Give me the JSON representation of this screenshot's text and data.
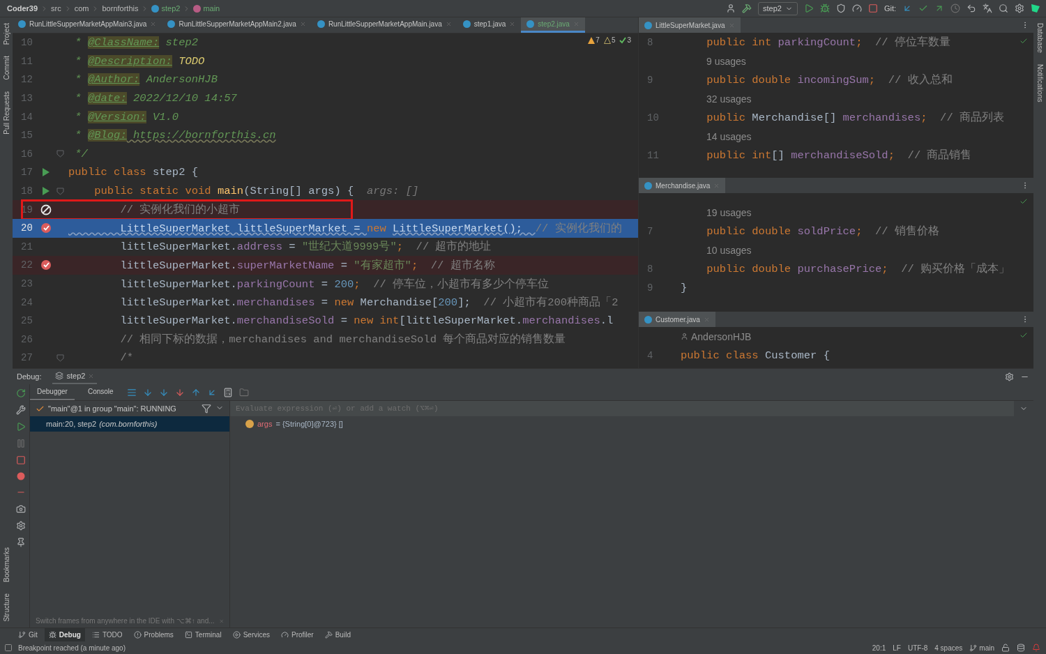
{
  "breadcrumbs": [
    {
      "label": "Coder39",
      "kind": "project"
    },
    {
      "label": "src",
      "kind": "folder"
    },
    {
      "label": "com",
      "kind": "folder"
    },
    {
      "label": "bornforthis",
      "kind": "folder"
    },
    {
      "label": "step2",
      "kind": "class"
    },
    {
      "label": "main",
      "kind": "method"
    }
  ],
  "run_config": "step2",
  "git_label": "Git:",
  "left_tools_top": [
    "Project",
    "Commit",
    "Pull Requests"
  ],
  "left_tools_bottom": [
    "Bookmarks",
    "Structure"
  ],
  "right_tools": [
    "Database",
    "Notifications"
  ],
  "editor": {
    "tabs": [
      {
        "label": "RunLittleSupperMarketAppMain3.java",
        "selected": false
      },
      {
        "label": "RunLittleSupperMarketAppMain2.java",
        "selected": false
      },
      {
        "label": "RunLittleSupperMarketAppMain.java",
        "selected": false
      },
      {
        "label": "step1.java",
        "selected": false
      },
      {
        "label": "step2.java",
        "selected": true
      }
    ],
    "inspections": [
      {
        "kind": "warning",
        "count": "7"
      },
      {
        "kind": "weak",
        "count": "5"
      },
      {
        "kind": "ok",
        "count": "3"
      }
    ],
    "lines": [
      {
        "number": "10",
        "run": false,
        "fold": false,
        "breakpoint": false,
        "muted": false,
        "current": false,
        "tokens": [
          {
            "text": " * ",
            "kind": "doc"
          },
          {
            "text": "@ClassName:",
            "kind": "tag"
          },
          {
            "text": " step2",
            "kind": "doc"
          }
        ]
      },
      {
        "number": "11",
        "run": false,
        "fold": false,
        "breakpoint": false,
        "muted": false,
        "current": false,
        "tokens": [
          {
            "text": " * ",
            "kind": "doc"
          },
          {
            "text": "@Description:",
            "kind": "tag"
          },
          {
            "text": " TODO",
            "kind": "todo"
          }
        ]
      },
      {
        "number": "12",
        "run": false,
        "fold": false,
        "breakpoint": false,
        "muted": false,
        "current": false,
        "tokens": [
          {
            "text": " * ",
            "kind": "doc"
          },
          {
            "text": "@Author:",
            "kind": "tag"
          },
          {
            "text": " AndersonHJB",
            "kind": "doc"
          }
        ]
      },
      {
        "number": "13",
        "run": false,
        "fold": false,
        "breakpoint": false,
        "muted": false,
        "current": false,
        "tokens": [
          {
            "text": " * ",
            "kind": "doc"
          },
          {
            "text": "@date:",
            "kind": "tag"
          },
          {
            "text": " 2022/12/10 14:57",
            "kind": "doc"
          }
        ]
      },
      {
        "number": "14",
        "run": false,
        "fold": false,
        "breakpoint": false,
        "muted": false,
        "current": false,
        "tokens": [
          {
            "text": " * ",
            "kind": "doc"
          },
          {
            "text": "@Version:",
            "kind": "tag"
          },
          {
            "text": " V1.0",
            "kind": "doc"
          }
        ]
      },
      {
        "number": "15",
        "run": false,
        "fold": false,
        "breakpoint": false,
        "muted": false,
        "current": false,
        "tokens": [
          {
            "text": " * ",
            "kind": "doc"
          },
          {
            "text": "@Blog:",
            "kind": "tag"
          },
          {
            "text": " https://bornforthis.cn",
            "kind": "url"
          }
        ]
      },
      {
        "number": "16",
        "run": false,
        "fold": true,
        "breakpoint": false,
        "muted": false,
        "current": false,
        "tokens": [
          {
            "text": " */",
            "kind": "doc"
          }
        ]
      },
      {
        "number": "17",
        "run": true,
        "fold": false,
        "breakpoint": false,
        "muted": false,
        "current": false,
        "tokens": [
          {
            "text": "public class ",
            "kind": "kw"
          },
          {
            "text": "step2 {",
            "kind": "pl"
          }
        ]
      },
      {
        "number": "18",
        "run": true,
        "fold": true,
        "breakpoint": false,
        "muted": false,
        "current": false,
        "tokens": [
          {
            "text": "    public static void ",
            "kind": "kw"
          },
          {
            "text": "main",
            "kind": "fn"
          },
          {
            "text": "(String[] args) {  ",
            "kind": "pl"
          },
          {
            "text": "args: []",
            "kind": "hint"
          }
        ]
      },
      {
        "number": "19",
        "run": false,
        "fold": false,
        "breakpoint": true,
        "muted": true,
        "current": false,
        "boxed": true,
        "tokens": [
          {
            "text": "        // 实例化我们的小超市",
            "kind": "cm"
          }
        ]
      },
      {
        "number": "20",
        "run": false,
        "fold": false,
        "breakpoint": true,
        "muted": false,
        "current": true,
        "tokens": [
          {
            "text": "        LittleSuperMarket littleSuperMarket = ",
            "kind": "cur"
          },
          {
            "text": "new ",
            "kind": "kw"
          },
          {
            "text": "LittleSuperMarket();  ",
            "kind": "cur"
          },
          {
            "text": "// 实例化我们的",
            "kind": "cm"
          }
        ]
      },
      {
        "number": "21",
        "run": false,
        "fold": false,
        "breakpoint": false,
        "muted": false,
        "current": false,
        "tokens": [
          {
            "text": "        littleSuperMarket.",
            "kind": "pl"
          },
          {
            "text": "address",
            "kind": "fld"
          },
          {
            "text": " = ",
            "kind": "pl"
          },
          {
            "text": "\"世纪大道9999号\"",
            "kind": "str"
          },
          {
            "text": ";  ",
            "kind": "kw"
          },
          {
            "text": "// 超市的地址",
            "kind": "cm"
          }
        ]
      },
      {
        "number": "22",
        "run": false,
        "fold": false,
        "breakpoint": true,
        "muted": false,
        "current": false,
        "tokens": [
          {
            "text": "        littleSuperMarket.",
            "kind": "pl"
          },
          {
            "text": "superMarketName",
            "kind": "fld"
          },
          {
            "text": " = ",
            "kind": "pl"
          },
          {
            "text": "\"有家超市\"",
            "kind": "str"
          },
          {
            "text": ";  ",
            "kind": "kw"
          },
          {
            "text": "// 超市名称",
            "kind": "cm"
          }
        ]
      },
      {
        "number": "23",
        "run": false,
        "fold": false,
        "breakpoint": false,
        "muted": false,
        "current": false,
        "tokens": [
          {
            "text": "        littleSuperMarket.",
            "kind": "pl"
          },
          {
            "text": "parkingCount",
            "kind": "fld"
          },
          {
            "text": " = ",
            "kind": "pl"
          },
          {
            "text": "200",
            "kind": "num"
          },
          {
            "text": ";  ",
            "kind": "kw"
          },
          {
            "text": "// 停车位，小超市有多少个停车位",
            "kind": "cm"
          }
        ]
      },
      {
        "number": "24",
        "run": false,
        "fold": false,
        "breakpoint": false,
        "muted": false,
        "current": false,
        "tokens": [
          {
            "text": "        littleSuperMarket.",
            "kind": "pl"
          },
          {
            "text": "merchandises",
            "kind": "fld"
          },
          {
            "text": " = ",
            "kind": "pl"
          },
          {
            "text": "new ",
            "kind": "kw"
          },
          {
            "text": "Merchandise[",
            "kind": "pl"
          },
          {
            "text": "200",
            "kind": "num"
          },
          {
            "text": "];  ",
            "kind": "pl"
          },
          {
            "text": "// 小超市有200种商品「2",
            "kind": "cm"
          }
        ]
      },
      {
        "number": "25",
        "run": false,
        "fold": false,
        "breakpoint": false,
        "muted": false,
        "current": false,
        "tokens": [
          {
            "text": "        littleSuperMarket.",
            "kind": "pl"
          },
          {
            "text": "merchandiseSold",
            "kind": "fld"
          },
          {
            "text": " = ",
            "kind": "pl"
          },
          {
            "text": "new int",
            "kind": "kw"
          },
          {
            "text": "[littleSuperMarket.",
            "kind": "pl"
          },
          {
            "text": "merchandises",
            "kind": "fld"
          },
          {
            "text": ".l",
            "kind": "pl"
          }
        ]
      },
      {
        "number": "26",
        "run": false,
        "fold": false,
        "breakpoint": false,
        "muted": false,
        "current": false,
        "tokens": [
          {
            "text": "        // 相同下标的数据，merchandises and merchandiseSold 每个商品对应的销售数量",
            "kind": "cm"
          }
        ]
      },
      {
        "number": "27",
        "run": false,
        "fold": true,
        "breakpoint": false,
        "muted": false,
        "current": false,
        "tokens": [
          {
            "text": "        /*",
            "kind": "cm"
          }
        ]
      }
    ]
  },
  "side_editors": [
    {
      "file": "LittleSuperMarket.java",
      "rows": [
        {
          "kind": "code",
          "number": "8",
          "tokens": [
            {
              "text": "    public int ",
              "kind": "kw"
            },
            {
              "text": "parkingCount",
              "kind": "fld"
            },
            {
              "text": ";  ",
              "kind": "kw"
            },
            {
              "text": "// 停位车数量",
              "kind": "cm"
            }
          ]
        },
        {
          "kind": "usages",
          "text": "9 usages"
        },
        {
          "kind": "code",
          "number": "9",
          "tokens": [
            {
              "text": "    public double ",
              "kind": "kw"
            },
            {
              "text": "incomingSum",
              "kind": "fld"
            },
            {
              "text": ";  ",
              "kind": "kw"
            },
            {
              "text": "// 收入总和",
              "kind": "cm"
            }
          ]
        },
        {
          "kind": "usages",
          "text": "32 usages"
        },
        {
          "kind": "code",
          "number": "10",
          "tokens": [
            {
              "text": "    public ",
              "kind": "kw"
            },
            {
              "text": "Merchandise[] ",
              "kind": "pl"
            },
            {
              "text": "merchandises",
              "kind": "fld"
            },
            {
              "text": ";  ",
              "kind": "kw"
            },
            {
              "text": "// 商品列表",
              "kind": "cm"
            }
          ]
        },
        {
          "kind": "usages",
          "text": "14 usages"
        },
        {
          "kind": "code",
          "number": "11",
          "tokens": [
            {
              "text": "    public int",
              "kind": "kw"
            },
            {
              "text": "[] ",
              "kind": "pl"
            },
            {
              "text": "merchandiseSold",
              "kind": "fld"
            },
            {
              "text": ";  ",
              "kind": "kw"
            },
            {
              "text": "// 商品销售",
              "kind": "cm"
            }
          ]
        }
      ]
    },
    {
      "file": "Merchandise.java",
      "rows": [
        {
          "kind": "usages",
          "text": "19 usages"
        },
        {
          "kind": "code",
          "number": "7",
          "tokens": [
            {
              "text": "    public double ",
              "kind": "kw"
            },
            {
              "text": "soldPrice",
              "kind": "fld"
            },
            {
              "text": ";  ",
              "kind": "kw"
            },
            {
              "text": "// 销售价格",
              "kind": "cm"
            }
          ]
        },
        {
          "kind": "usages",
          "text": "10 usages"
        },
        {
          "kind": "code",
          "number": "8",
          "tokens": [
            {
              "text": "    public double ",
              "kind": "kw"
            },
            {
              "text": "purchasePrice",
              "kind": "fld"
            },
            {
              "text": ";  ",
              "kind": "kw"
            },
            {
              "text": "// 购买价格「成本」",
              "kind": "cm"
            }
          ]
        },
        {
          "kind": "code",
          "number": "9",
          "tokens": [
            {
              "text": "}",
              "kind": "pl"
            }
          ]
        }
      ]
    },
    {
      "file": "Customer.java",
      "rows": [
        {
          "kind": "author",
          "text": "AndersonHJB"
        },
        {
          "kind": "code",
          "number": "4",
          "tokens": [
            {
              "text": "public class ",
              "kind": "kw"
            },
            {
              "text": "Customer {",
              "kind": "pl"
            }
          ]
        }
      ]
    }
  ],
  "debug": {
    "title": "Debug:",
    "session": "step2",
    "tabs": [
      {
        "label": "Debugger",
        "selected": true
      },
      {
        "label": "Console",
        "selected": false
      }
    ],
    "thread": "\"main\"@1 in group \"main\": RUNNING",
    "frames": [
      {
        "method": "main:20, step2",
        "package": "(com.bornforthis)",
        "selected": true
      }
    ],
    "hint": "Switch frames from anywhere in the IDE with ⌥⌘↑ and...",
    "evaluate_placeholder": "Evaluate expression (⏎) or add a watch (⌥⌘⏎)",
    "variables": [
      {
        "name": "args",
        "value": "= {String[0]@723} []"
      }
    ]
  },
  "tool_windows": [
    {
      "label": "Git",
      "kind": "git",
      "selected": false
    },
    {
      "label": "Debug",
      "kind": "debug",
      "selected": true
    },
    {
      "label": "TODO",
      "kind": "todo",
      "selected": false
    },
    {
      "label": "Problems",
      "kind": "problems",
      "selected": false
    },
    {
      "label": "Terminal",
      "kind": "terminal",
      "selected": false
    },
    {
      "label": "Services",
      "kind": "services",
      "selected": false
    },
    {
      "label": "Profiler",
      "kind": "profiler",
      "selected": false
    },
    {
      "label": "Build",
      "kind": "build",
      "selected": false
    }
  ],
  "status": {
    "message": "Breakpoint reached (a minute ago)",
    "items": [
      "20:1",
      "LF",
      "UTF-8",
      "4 spaces"
    ],
    "branch": "main"
  }
}
